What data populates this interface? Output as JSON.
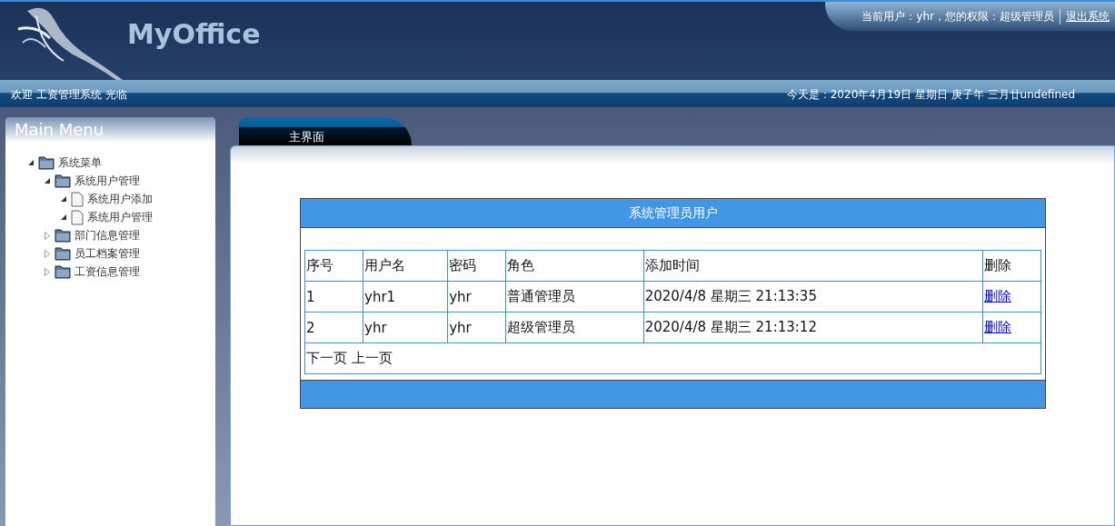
{
  "header": {
    "logo": "MyOffice",
    "user_info": "当前用户：yhr，您的权限：超级管理员",
    "logout": "退出系统"
  },
  "welcome_bar": {
    "welcome": "欢迎 工资管理系统 光临",
    "date": "今天是：2020年4月19日 星期日 庚子年 三月廿undefined"
  },
  "sidebar": {
    "title": "Main Menu",
    "tree": [
      {
        "label": "系统菜单",
        "kind": "folder",
        "expanded": true,
        "children": [
          {
            "label": "系统用户管理",
            "kind": "folder",
            "expanded": true,
            "children": [
              {
                "label": "系统用户添加",
                "kind": "file",
                "expanded": true
              },
              {
                "label": "系统用户管理",
                "kind": "file",
                "expanded": true
              }
            ]
          },
          {
            "label": "部门信息管理",
            "kind": "folder",
            "expanded": false
          },
          {
            "label": "员工档案管理",
            "kind": "folder",
            "expanded": false
          },
          {
            "label": "工资信息管理",
            "kind": "folder",
            "expanded": false
          }
        ]
      }
    ]
  },
  "tabs": [
    {
      "label": "主界面",
      "selected": true
    }
  ],
  "table": {
    "title": "系统管理员用户",
    "columns": [
      "序号",
      "用户名",
      "密码",
      "角色",
      "添加时间",
      "删除"
    ],
    "rows": [
      [
        "1",
        "yhr1",
        "yhr",
        "普通管理员",
        "2020/4/8 星期三 21:13:35",
        "删除"
      ],
      [
        "2",
        "yhr",
        "yhr",
        "超级管理员",
        "2020/4/8 星期三 21:13:12",
        "删除"
      ]
    ],
    "pager": "下一页 上一页"
  }
}
